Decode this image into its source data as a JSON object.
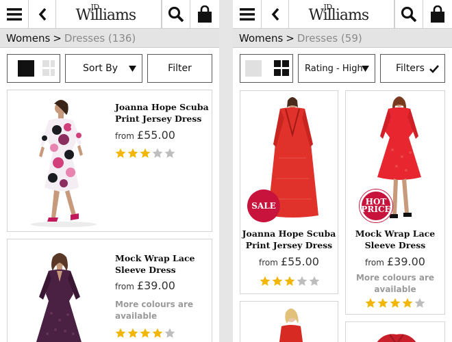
{
  "brand": {
    "small": "JD",
    "name": "Williams"
  },
  "left": {
    "breadcrumb": {
      "parent": "Womens",
      "sep": ">",
      "current": "Dresses (136)"
    },
    "toolbar": {
      "sort_label": "Sort By",
      "filter_label": "Filter"
    },
    "products": [
      {
        "name": "Joanna Hope Scuba Print Jersey Dress",
        "from": "from",
        "price": "£55.00",
        "rating": 3
      },
      {
        "name": "Mock Wrap Lace Sleeve Dress",
        "from": "from",
        "price": "£39.00",
        "more_colours": "More colours are available",
        "rating": 4
      }
    ]
  },
  "right": {
    "breadcrumb": {
      "parent": "Womens",
      "sep": ">",
      "current": "Dresses (59)"
    },
    "toolbar": {
      "sort_label": "Rating - High",
      "filter_label": "Filters"
    },
    "products": [
      {
        "name": "Joanna Hope Scuba Print Jersey Dress",
        "from": "from",
        "price": "£55.00",
        "badge": "SALE",
        "rating": 3
      },
      {
        "name": "Mock Wrap Lace Sleeve Dress",
        "from": "from",
        "price": "£39.00",
        "badge": "HOT PRICE",
        "badge_line1": "HOT",
        "badge_line2": "PRICE",
        "more_colours": "More colours are available",
        "rating": 4
      }
    ]
  },
  "colors": {
    "star_on": "#f2b705",
    "star_off": "#bdbdbd",
    "badge": "#c8143c"
  },
  "icons": [
    "hamburger-menu-icon",
    "back-chevron-icon",
    "search-icon",
    "shopping-bag-icon",
    "grid-view-icon",
    "chevron-down-icon",
    "checkmark-icon",
    "star-icon"
  ]
}
